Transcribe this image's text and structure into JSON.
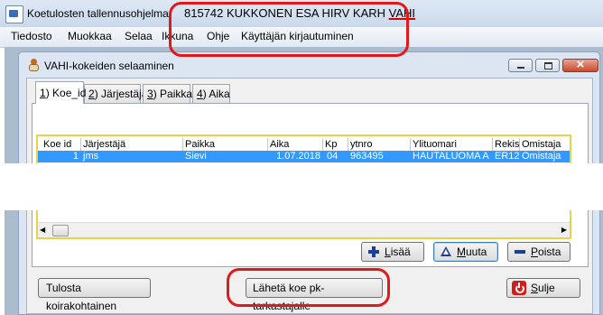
{
  "titlebar": {
    "app_name": "Koetulosten tallennusohjelma",
    "info_prefix": "815742 KUKKONEN ESA HIRV KARH ",
    "info_suffix": "VAHI"
  },
  "menubar": {
    "items": [
      "Tiedosto",
      "Muokkaa",
      "Selaa",
      "Ikkuna",
      "Ohje",
      "Käyttäjän kirjautuminen"
    ]
  },
  "child_window": {
    "title": "VAHI-kokeiden selaaminen"
  },
  "tabs": [
    {
      "key": "1",
      "rest": ") Koe_id"
    },
    {
      "key": "2",
      "rest": ") Järjestäjä"
    },
    {
      "key": "3",
      "rest": ") Paikka"
    },
    {
      "key": "4",
      "rest": ") Aika"
    }
  ],
  "grid": {
    "columns": [
      "Koe id",
      "Järjestäjä",
      "Paikka",
      "Aika",
      "Kp",
      "ytnro",
      "Ylituomari",
      "Rekis",
      "Omistaja"
    ],
    "rows": [
      [
        "1",
        "jms",
        "Sievi",
        "1.07.2018",
        "04",
        "963495",
        "HAUTALUOMA A",
        "ER12",
        "Omistaja"
      ]
    ]
  },
  "buttons": {
    "add": {
      "first": "L",
      "rest": "isää"
    },
    "edit": {
      "first": "M",
      "rest": "uuta"
    },
    "delete": {
      "first": "P",
      "rest": "oista"
    },
    "print": "Tulosta koirakohtainen",
    "send": "Lähetä koe pk-tarkastajalle",
    "close": {
      "first": "S",
      "rest": "ulje"
    }
  },
  "colors": {
    "annotation": "#e0191b",
    "selection": "#3399ff",
    "grid_border": "#e6d34a"
  }
}
